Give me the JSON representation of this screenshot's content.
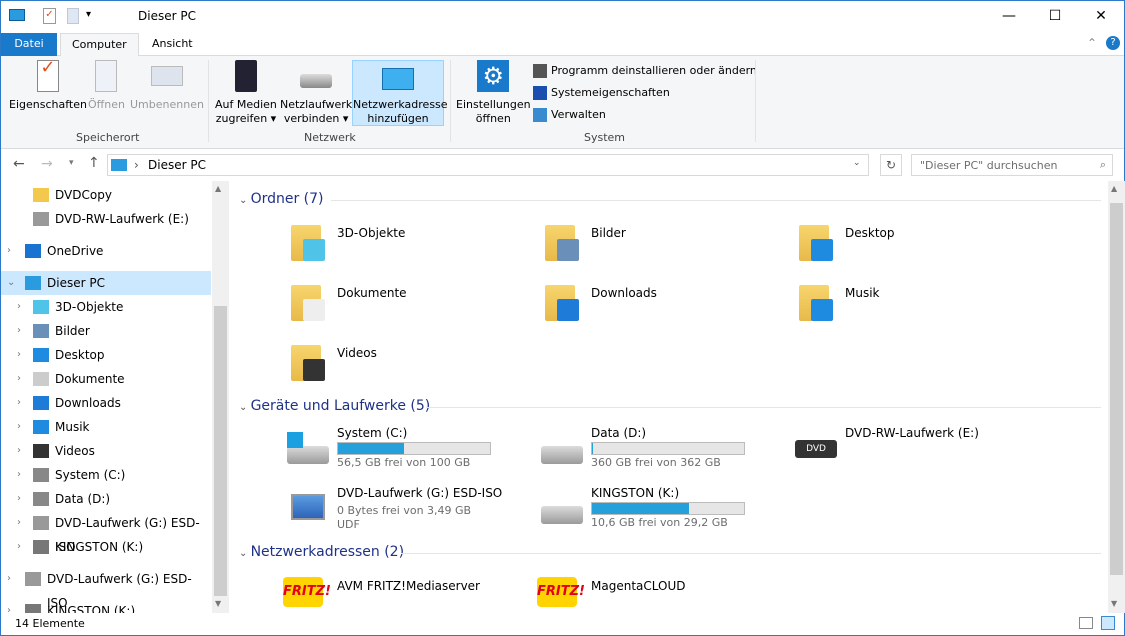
{
  "window": {
    "title": "Dieser PC",
    "minimize": "—",
    "maximize": "☐",
    "close": "✕"
  },
  "ribbon": {
    "tabs": [
      "Datei",
      "Computer",
      "Ansicht"
    ],
    "groups": {
      "speicherort": {
        "label": "Speicherort",
        "buttons": [
          "Eigenschaften",
          "Öffnen",
          "Umbenennen"
        ]
      },
      "netzwerk": {
        "label": "Netzwerk",
        "buttons": [
          {
            "l1": "Auf Medien",
            "l2": "zugreifen ▾"
          },
          {
            "l1": "Netzlaufwerk",
            "l2": "verbinden ▾"
          },
          {
            "l1": "Netzwerkadresse",
            "l2": "hinzufügen"
          }
        ]
      },
      "system": {
        "label": "System",
        "settings": {
          "l1": "Einstellungen",
          "l2": "öffnen"
        },
        "small": [
          "Programm deinstallieren oder ändern",
          "Systemeigenschaften",
          "Verwalten"
        ]
      }
    }
  },
  "address": {
    "path": "Dieser PC",
    "search_placeholder": "\"Dieser PC\" durchsuchen"
  },
  "nav": [
    "DVDCopy",
    "DVD-RW-Laufwerk (E:)",
    "OneDrive",
    "Dieser PC",
    "3D-Objekte",
    "Bilder",
    "Desktop",
    "Dokumente",
    "Downloads",
    "Musik",
    "Videos",
    "System (C:)",
    "Data (D:)",
    "DVD-Laufwerk (G:) ESD-ISO",
    "KINGSTON (K:)",
    "DVD-Laufwerk (G:) ESD-ISO",
    "KINGSTON (K:)"
  ],
  "content": {
    "folders_header": "Ordner (7)",
    "folders": [
      "3D-Objekte",
      "Bilder",
      "Desktop",
      "Dokumente",
      "Downloads",
      "Musik",
      "Videos"
    ],
    "drives_header": "Geräte und Laufwerke (5)",
    "drives": [
      {
        "name": "System (C:)",
        "info": "56,5 GB frei von 100 GB",
        "used": 0.435
      },
      {
        "name": "Data (D:)",
        "info": "360 GB frei von 362 GB",
        "used": 0.006
      },
      {
        "name": "DVD-RW-Laufwerk (E:)"
      },
      {
        "name": "DVD-Laufwerk (G:) ESD-ISO",
        "info": "0 Bytes frei von 3,49 GB",
        "fs": "UDF"
      },
      {
        "name": "KINGSTON (K:)",
        "info": "10,6 GB frei von 29,2 GB",
        "used": 0.637
      }
    ],
    "network_header": "Netzwerkadressen (2)",
    "network": [
      "AVM FRITZ!Mediaserver",
      "MagentaCLOUD"
    ],
    "fritz_logo": "FRITZ!"
  },
  "status": {
    "count": "14 Elemente"
  },
  "colors": {
    "accent": "#1979ca",
    "bar": "#26a0da",
    "header": "#1e3287"
  }
}
